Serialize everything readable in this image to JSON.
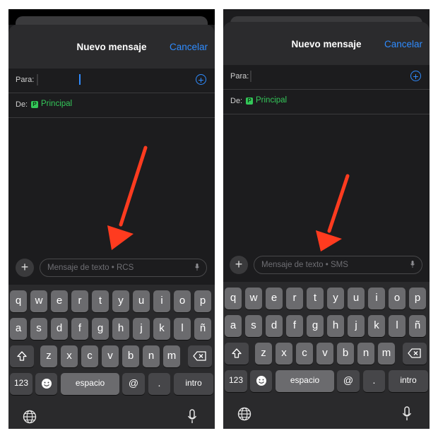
{
  "colors": {
    "accent_blue": "#2f8cff",
    "sender_green": "#34c759",
    "arrow_red": "#ff3b1f",
    "sheet_bg": "#1c1c1e",
    "key_bg": "#6b6b6e"
  },
  "screens": [
    {
      "header": {
        "title": "Nuevo mensaje",
        "cancel": "Cancelar"
      },
      "to_label": "Para:",
      "from_label": "De:",
      "from_badge": "P",
      "from_value": "Principal",
      "compose_plus": "+",
      "compose_placeholder": "Mensaje de texto • RCS",
      "icons": [
        "plus-circle-icon",
        "shift-icon",
        "backspace-icon",
        "emoji-icon",
        "globe-icon",
        "mic-icon",
        "red-arrow"
      ]
    },
    {
      "header": {
        "title": "Nuevo mensaje",
        "cancel": "Cancelar"
      },
      "to_label": "Para:",
      "from_label": "De:",
      "from_badge": "P",
      "from_value": "Principal",
      "compose_plus": "+",
      "compose_placeholder": "Mensaje de texto • SMS",
      "icons": [
        "plus-circle-icon",
        "shift-icon",
        "backspace-icon",
        "emoji-icon",
        "globe-icon",
        "mic-icon",
        "red-arrow"
      ]
    }
  ],
  "keyboard": {
    "row1": [
      "q",
      "w",
      "e",
      "r",
      "t",
      "y",
      "u",
      "i",
      "o",
      "p"
    ],
    "row2": [
      "a",
      "s",
      "d",
      "f",
      "g",
      "h",
      "j",
      "k",
      "l",
      "ñ"
    ],
    "row3": [
      "z",
      "x",
      "c",
      "v",
      "b",
      "n",
      "m"
    ],
    "numbers_key": "123",
    "at_key": "@",
    "dot_key": ".",
    "space_key": "espacio",
    "return_key": "intro"
  }
}
